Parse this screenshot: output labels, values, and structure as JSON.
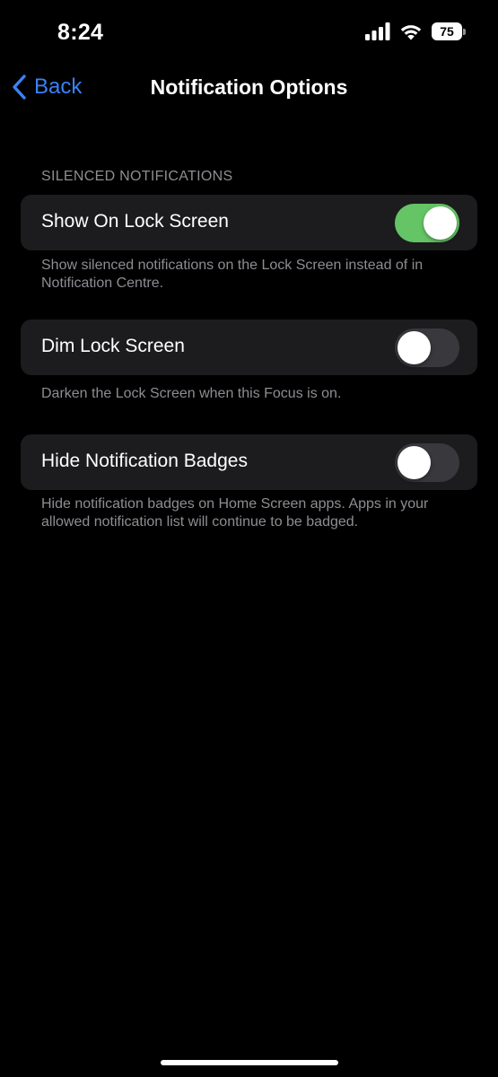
{
  "status_bar": {
    "time": "8:24",
    "battery_level": "75",
    "icons": [
      "signal-icon",
      "wifi-icon",
      "battery-icon"
    ]
  },
  "nav": {
    "back_label": "Back",
    "title": "Notification Options",
    "back_icon": "chevron-left-icon",
    "accent_color": "#3a82f7"
  },
  "section": {
    "header": "SILENCED NOTIFICATIONS"
  },
  "settings": [
    {
      "label": "Show On Lock Screen",
      "enabled": true,
      "footer": "Show silenced notifications on the Lock Screen instead of in Notification Centre."
    },
    {
      "label": "Dim Lock Screen",
      "enabled": false,
      "footer": "Darken the Lock Screen when this Focus is on."
    },
    {
      "label": "Hide Notification Badges",
      "enabled": false,
      "footer": "Hide notification badges on Home Screen apps. Apps in your allowed notification list will continue to be badged."
    }
  ],
  "colors": {
    "background": "#000000",
    "cell_background": "#1c1c1e",
    "toggle_on": "#65c466",
    "toggle_off": "#39393d",
    "secondary_text": "#8d8d93"
  }
}
